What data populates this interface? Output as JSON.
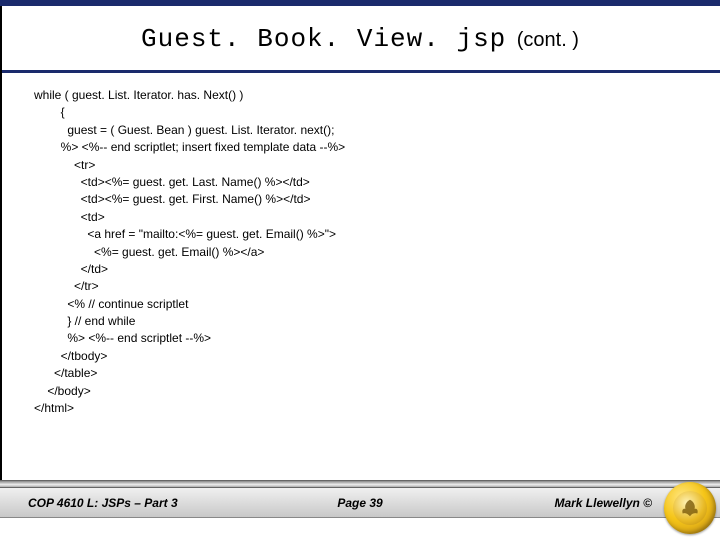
{
  "title": {
    "main": "Guest. Book. View. jsp",
    "cont": "(cont. )"
  },
  "code": "while ( guest. List. Iterator. has. Next() )\n        {\n          guest = ( Guest. Bean ) guest. List. Iterator. next();\n        %> <%-- end scriptlet; insert fixed template data --%>\n            <tr>\n              <td><%= guest. get. Last. Name() %></td>\n              <td><%= guest. get. First. Name() %></td>\n              <td>\n                <a href = \"mailto:<%= guest. get. Email() %>\">\n                  <%= guest. get. Email() %></a>\n              </td>\n            </tr>\n          <% // continue scriptlet\n          } // end while\n          %> <%-- end scriptlet --%>\n        </tbody>\n      </table>\n    </body>\n</html>",
  "footer": {
    "left": "COP 4610 L: JSPs – Part 3",
    "center": "Page 39",
    "right": "Mark Llewellyn ©"
  }
}
